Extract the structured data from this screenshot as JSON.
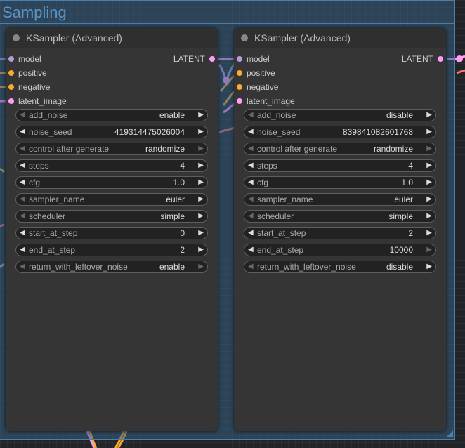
{
  "group": {
    "title": "Sampling"
  },
  "colors": {
    "model": "#b39ddb",
    "conditioning": "#ffa931",
    "latent": "#ff9cf9",
    "vae_wire": "#ff6e6e"
  },
  "nodes": [
    {
      "title": "KSampler (Advanced)",
      "inputs": [
        {
          "label": "model",
          "color": "#b39ddb"
        },
        {
          "label": "positive",
          "color": "#ffa931"
        },
        {
          "label": "negative",
          "color": "#ffa931"
        },
        {
          "label": "latent_image",
          "color": "#ff9cf9"
        }
      ],
      "output": {
        "label": "LATENT",
        "color": "#ff9cf9"
      },
      "widgets": [
        {
          "name": "add_noise",
          "value": "enable"
        },
        {
          "name": "noise_seed",
          "value": "419314475026004"
        },
        {
          "name": "control after generate",
          "value": "randomize"
        },
        {
          "name": "steps",
          "value": "4"
        },
        {
          "name": "cfg",
          "value": "1.0"
        },
        {
          "name": "sampler_name",
          "value": "euler"
        },
        {
          "name": "scheduler",
          "value": "simple"
        },
        {
          "name": "start_at_step",
          "value": "0"
        },
        {
          "name": "end_at_step",
          "value": "2"
        },
        {
          "name": "return_with_leftover_noise",
          "value": "enable"
        }
      ]
    },
    {
      "title": "KSampler (Advanced)",
      "inputs": [
        {
          "label": "model",
          "color": "#b39ddb"
        },
        {
          "label": "positive",
          "color": "#ffa931"
        },
        {
          "label": "negative",
          "color": "#ffa931"
        },
        {
          "label": "latent_image",
          "color": "#ff9cf9"
        }
      ],
      "output": {
        "label": "LATENT",
        "color": "#ff9cf9"
      },
      "widgets": [
        {
          "name": "add_noise",
          "value": "disable"
        },
        {
          "name": "noise_seed",
          "value": "839841082601768"
        },
        {
          "name": "control after generate",
          "value": "randomize"
        },
        {
          "name": "steps",
          "value": "4"
        },
        {
          "name": "cfg",
          "value": "1.0"
        },
        {
          "name": "sampler_name",
          "value": "euler"
        },
        {
          "name": "scheduler",
          "value": "simple"
        },
        {
          "name": "start_at_step",
          "value": "2"
        },
        {
          "name": "end_at_step",
          "value": "10000"
        },
        {
          "name": "return_with_leftover_noise",
          "value": "disable"
        }
      ]
    }
  ]
}
